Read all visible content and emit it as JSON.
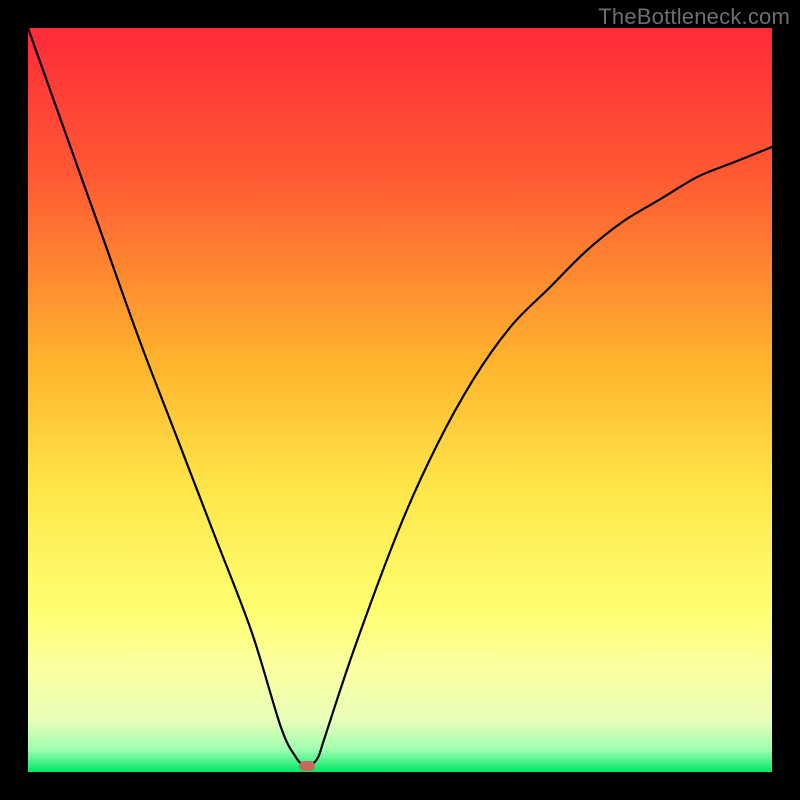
{
  "watermark": "TheBottleneck.com",
  "colors": {
    "frame": "#000000",
    "curve": "#000000",
    "marker": "#c6695c",
    "gradient_stops": [
      {
        "pct": 0,
        "color": "#ff2a3a"
      },
      {
        "pct": 20,
        "color": "#ff5a33"
      },
      {
        "pct": 45,
        "color": "#ffb42e"
      },
      {
        "pct": 62,
        "color": "#ffe64a"
      },
      {
        "pct": 78,
        "color": "#feff70"
      },
      {
        "pct": 86,
        "color": "#fcffa0"
      },
      {
        "pct": 93,
        "color": "#e8ffb8"
      },
      {
        "pct": 97,
        "color": "#9fffb0"
      },
      {
        "pct": 100,
        "color": "#00e765"
      }
    ]
  },
  "chart_data": {
    "type": "line",
    "title": "",
    "xlabel": "",
    "ylabel": "",
    "xlim": [
      0,
      100
    ],
    "ylim": [
      0,
      100
    ],
    "grid": false,
    "legend": false,
    "series": [
      {
        "name": "curve",
        "x": [
          0,
          5,
          10,
          15,
          20,
          25,
          30,
          34,
          36,
          37,
          38,
          39,
          40,
          44,
          50,
          55,
          60,
          65,
          70,
          75,
          80,
          85,
          90,
          95,
          100
        ],
        "y": [
          100,
          86,
          72,
          58,
          45,
          32,
          19,
          6,
          2,
          1,
          1,
          2,
          5,
          17,
          33,
          44,
          53,
          60,
          65,
          70,
          74,
          77,
          80,
          82,
          84
        ]
      }
    ],
    "marker": {
      "x": 37.5,
      "y": 0.8
    },
    "notes": "x and y are in percent of plot area; origin at bottom-left; values visually estimated"
  }
}
